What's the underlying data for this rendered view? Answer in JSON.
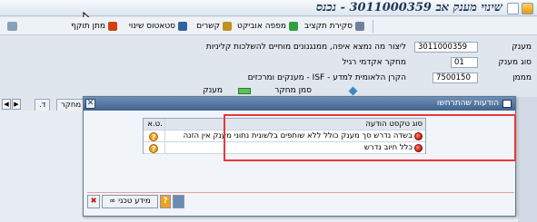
{
  "title": "שינוי מענק אב 3011000359 - נכנס",
  "toolbar": {
    "items": [
      {
        "label": "מתן תוקף",
        "icon": "validate-icon",
        "color": "#d04010"
      },
      {
        "label": "סטאטוס שינוי",
        "icon": "status-icon",
        "color": "#3060a0"
      },
      {
        "label": "קשרים",
        "icon": "links-icon",
        "color": "#c09020"
      },
      {
        "label": "מפפה אוביקט",
        "icon": "object-icon",
        "color": "#30a040"
      },
      {
        "label": "סקירת תקציב",
        "icon": "budget-icon",
        "color": "#7080a0"
      }
    ]
  },
  "form": {
    "grant_label": "מענק",
    "grant_value": "3011000359",
    "grant_desc": "ליצור מה נמצא איפה, ממנגנונים מוחיים להשלכות קליניות",
    "grant_type_label": "סוג מענק",
    "grant_type_value": "01",
    "grant_type_desc": "מחקר אקדמי רגיל",
    "sponsor_label": "מממן",
    "sponsor_value": "7500150",
    "sponsor_desc": "הקרן הלאומית למדע - ISF - מענקים ומרכזים",
    "research_mark_label": "סמן מחקר",
    "grant_mark_label": "מענק"
  },
  "tabs": {
    "items": [
      "מחקר",
      "ד."
    ]
  },
  "dialog": {
    "title": "הודעות שהתרחשו",
    "header_type": "סוג",
    "header_message": "טקסט הודעה",
    "header_ta": "ט.א.",
    "rows": [
      {
        "text": "בשדה נדרש סך מענק כולל ללא שותפים בלשונית נתוני מענק אין הזנה"
      },
      {
        "text": "כלל חיוב נדרש"
      }
    ],
    "buttons": {
      "info_label": "מידע טכני"
    }
  }
}
